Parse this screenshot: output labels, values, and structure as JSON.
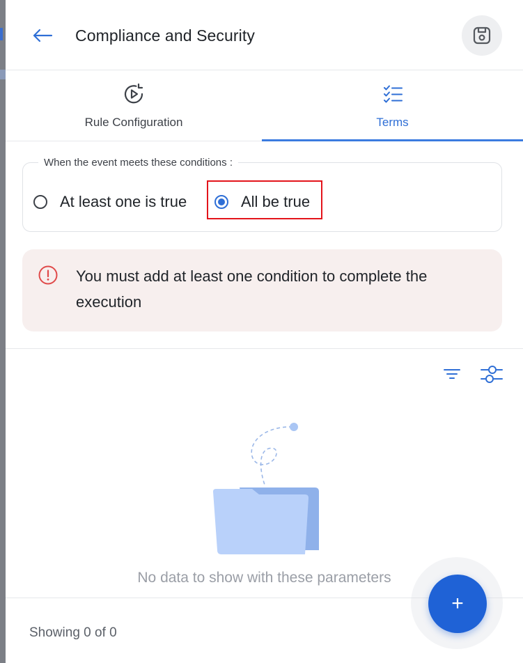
{
  "header": {
    "title": "Compliance and Security",
    "back_icon": "arrow-left-icon",
    "save_icon": "save-icon"
  },
  "tabs": [
    {
      "label": "Rule Configuration",
      "icon": "play-refresh-icon",
      "active": false
    },
    {
      "label": "Terms",
      "icon": "checklist-icon",
      "active": true
    }
  ],
  "conditions": {
    "legend": "When the event meets these conditions :",
    "options": [
      {
        "label": "At least one is true",
        "selected": false
      },
      {
        "label": "All be true",
        "selected": true
      }
    ]
  },
  "alert": {
    "icon": "alert-circle-icon",
    "message": "You must add at least one condition to complete the execution"
  },
  "toolbar": {
    "filter_icon": "filter-lines-icon",
    "settings_icon": "sliders-icon"
  },
  "empty_state": {
    "message": "No data to show with these parameters",
    "illustration": "empty-folder-icon"
  },
  "footer": {
    "showing": "Showing 0 of 0"
  },
  "fab": {
    "label": "+"
  },
  "colors": {
    "accent": "#2f6fd6",
    "fab": "#1f62d6",
    "highlight": "#e3141b",
    "alert_bg": "#f7efee",
    "alert_icon": "#e04a4a"
  }
}
